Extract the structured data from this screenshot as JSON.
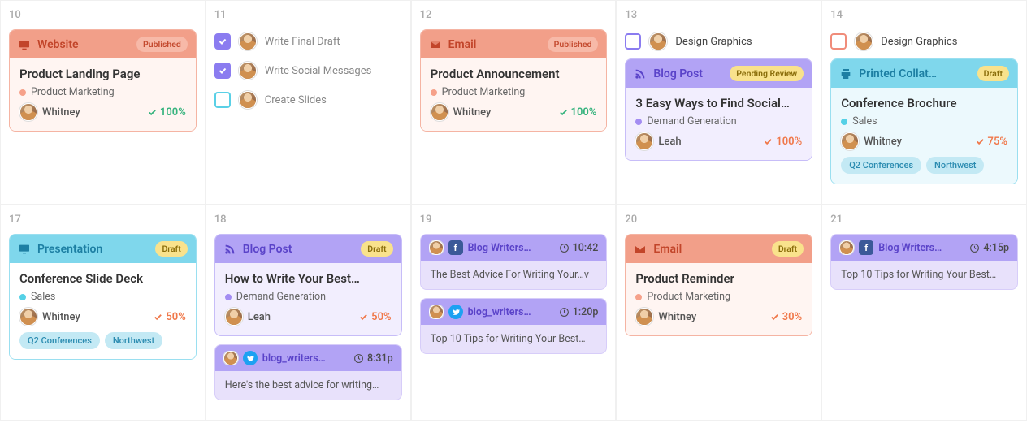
{
  "days": {
    "d10": {
      "num": "10",
      "card": {
        "type": "Website",
        "status": "Published",
        "title": "Product Landing Page",
        "category": "Product Marketing",
        "assignee": "Whitney",
        "pct": "100%",
        "pct_color": "green"
      }
    },
    "d11": {
      "num": "11",
      "tasks": [
        {
          "done": true,
          "style": "purple",
          "label": "Write Final Draft"
        },
        {
          "done": true,
          "style": "purple",
          "label": "Write Social Messages"
        },
        {
          "done": false,
          "style": "teal-outline",
          "label": "Create Slides"
        }
      ]
    },
    "d12": {
      "num": "12",
      "card": {
        "type": "Email",
        "status": "Published",
        "title": "Product Announcement",
        "category": "Product Marketing",
        "assignee": "Whitney",
        "pct": "100%",
        "pct_color": "green"
      }
    },
    "d13": {
      "num": "13",
      "pretask": {
        "style": "purple-outline",
        "label": "Design Graphics"
      },
      "card": {
        "type": "Blog Post",
        "status": "Pending Review",
        "title": "3 Easy Ways to Find Social…",
        "category": "Demand Generation",
        "assignee": "Leah",
        "pct": "100%",
        "pct_color": "orange"
      }
    },
    "d14": {
      "num": "14",
      "pretask": {
        "style": "orange-outline",
        "label": "Design Graphics"
      },
      "card": {
        "type": "Printed Collat…",
        "status": "Draft",
        "title": "Conference Brochure",
        "category": "Sales",
        "assignee": "Whitney",
        "pct": "75%",
        "pct_color": "orange",
        "tags": [
          "Q2 Conferences",
          "Northwest"
        ]
      }
    },
    "d17": {
      "num": "17",
      "card": {
        "type": "Presentation",
        "status": "Draft",
        "title": "Conference Slide Deck",
        "category": "Sales",
        "assignee": "Whitney",
        "pct": "50%",
        "pct_color": "orange",
        "tags": [
          "Q2 Conferences",
          "Northwest"
        ]
      }
    },
    "d18": {
      "num": "18",
      "card": {
        "type": "Blog Post",
        "status": "Draft",
        "title": "How to Write Your Best…",
        "category": "Demand Generation",
        "assignee": "Leah",
        "pct": "50%",
        "pct_color": "orange"
      },
      "social": {
        "network": "tw",
        "account": "blog_writers…",
        "time": "8:31p",
        "text": "Here's the best advice for writing…"
      }
    },
    "d19": {
      "num": "19",
      "social1": {
        "network": "fb",
        "account": "Blog Writers…",
        "time": "10:42",
        "text": "The Best Advice For Writing Your…v"
      },
      "social2": {
        "network": "tw",
        "account": "blog_writers…",
        "time": "1:20p",
        "text": "Top 10 Tips for Writing Your Best…"
      }
    },
    "d20": {
      "num": "20",
      "card": {
        "type": "Email",
        "status": "Draft",
        "title": "Product Reminder",
        "category": "Product Marketing",
        "assignee": "Whitney",
        "pct": "30%",
        "pct_color": "orange"
      }
    },
    "d21": {
      "num": "21",
      "social": {
        "network": "fb",
        "account": "Blog Writers…",
        "time": "4:15p",
        "text": "Top 10 Tips for Writing Your Best…"
      }
    }
  }
}
